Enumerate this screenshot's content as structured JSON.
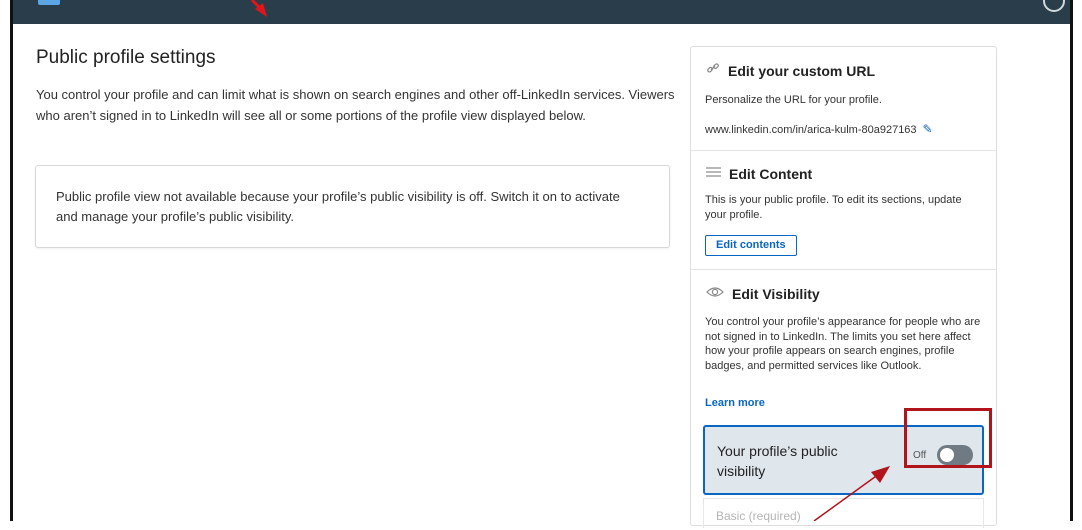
{
  "main": {
    "title": "Public profile settings",
    "description": "You control your profile and can limit what is shown on search engines and other off-LinkedIn services. Viewers who aren’t signed in to LinkedIn will see all or some portions of the profile view displayed below.",
    "notice": "Public profile view not available because your profile’s public visibility is off. Switch it on to activate and manage your profile’s public visibility."
  },
  "sidebar": {
    "custom_url": {
      "icon": "link-icon",
      "title": "Edit your custom URL",
      "text": "Personalize the URL for your profile.",
      "url": "www.linkedin.com/in/arica-kulm-80a927163"
    },
    "content": {
      "icon": "lines-icon",
      "title": "Edit Content",
      "text": "This is your public profile. To edit its sections, update your profile.",
      "button_label": "Edit contents"
    },
    "visibility": {
      "icon": "eye-icon",
      "title": "Edit Visibility",
      "text": "You control your profile’s appearance for people who are not signed in to LinkedIn. The limits you set here affect how your profile appears on search engines, profile badges, and permitted services like Outlook.",
      "learn_more": "Learn more",
      "public_label": "Your profile’s public visibility",
      "toggle_state": "Off",
      "basic_label": "Basic (required)"
    }
  },
  "colors": {
    "accent": "#0a66c2",
    "topbar": "#293e4a",
    "annotation_red": "#b2141b"
  }
}
